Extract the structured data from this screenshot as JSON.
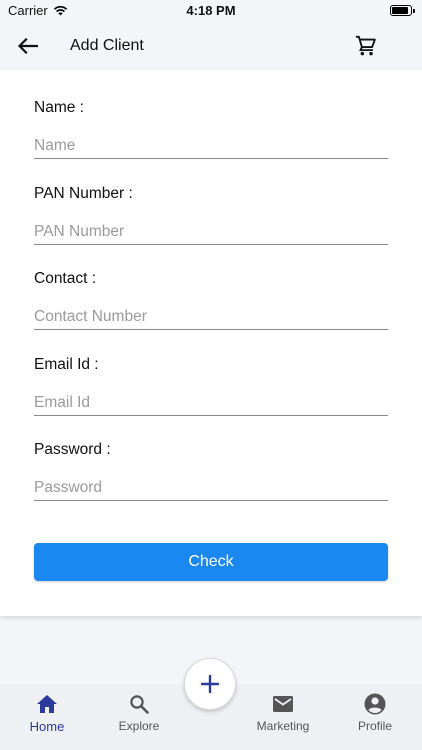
{
  "status_bar": {
    "carrier": "Carrier",
    "time": "4:18 PM"
  },
  "app_bar": {
    "title": "Add Client",
    "back_icon": "arrow-left-icon",
    "cart_icon": "cart-icon"
  },
  "form": {
    "fields": [
      {
        "label": "Name :",
        "placeholder": "Name",
        "value": ""
      },
      {
        "label": "PAN Number :",
        "placeholder": "PAN Number",
        "value": ""
      },
      {
        "label": "Contact :",
        "placeholder": "Contact Number",
        "value": ""
      },
      {
        "label": "Email Id :",
        "placeholder": "Email Id",
        "value": ""
      },
      {
        "label": "Password :",
        "placeholder": "Password",
        "value": ""
      }
    ],
    "submit_label": "Check"
  },
  "bottom_nav": {
    "items": [
      {
        "label": "Home",
        "icon": "home-icon",
        "active": true
      },
      {
        "label": "Explore",
        "icon": "search-icon",
        "active": false
      },
      {
        "label": "Marketing",
        "icon": "mail-icon",
        "active": false
      },
      {
        "label": "Profile",
        "icon": "account-circle-icon",
        "active": false
      }
    ],
    "fab_icon": "plus-icon"
  },
  "colors": {
    "primary_button": "#1a88f0",
    "active_nav": "#2b3a9b",
    "fab_plus": "#2b3a9b",
    "inactive_nav": "#555555",
    "background": "#f4f5f8"
  }
}
